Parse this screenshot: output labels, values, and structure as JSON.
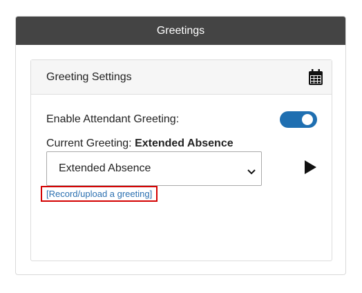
{
  "panel": {
    "title": "Greetings"
  },
  "card": {
    "title": "Greeting Settings",
    "header_icon": "calendar-icon"
  },
  "enable": {
    "label": "Enable Attendant Greeting:",
    "toggle_on": true,
    "toggle_color": "#1f6fb1"
  },
  "current": {
    "label": "Current Greeting:",
    "value": "Extended Absence"
  },
  "select": {
    "selected": "Extended Absence"
  },
  "play_icon": "play-icon",
  "record_link": {
    "text": "[Record/upload a greeting]",
    "highlight_color": "#d40000"
  }
}
